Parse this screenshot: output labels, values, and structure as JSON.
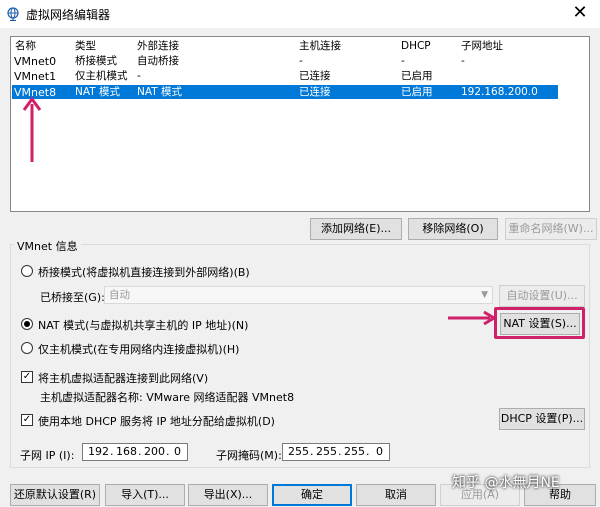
{
  "window": {
    "title": "虚拟网络编辑器",
    "close": "✕"
  },
  "table": {
    "headers": [
      "名称",
      "类型",
      "外部连接",
      "主机连接",
      "DHCP",
      "子网地址"
    ],
    "rows": [
      [
        "VMnet0",
        "桥接模式",
        "自动桥接",
        "-",
        "-",
        "-"
      ],
      [
        "VMnet1",
        "仅主机模式",
        "-",
        "已连接",
        "已启用",
        ""
      ],
      [
        "VMnet8",
        "NAT 模式",
        "NAT 模式",
        "已连接",
        "已启用",
        "192.168.200.0"
      ]
    ],
    "selected_row": 2
  },
  "list_buttons": {
    "add": "添加网络(E)...",
    "remove": "移除网络(O)",
    "rename": "重命名网络(W)..."
  },
  "vmnet_info": {
    "title": "VMnet 信息",
    "bridge_label": "桥接模式(将虚拟机直接连接到外部网络)(B)",
    "bridged_to_label": "已桥接至(G):",
    "bridged_to_value": "自动",
    "auto_settings": "自动设置(U)...",
    "nat_label": "NAT 模式(与虚拟机共享主机的 IP 地址)(N)",
    "nat_settings": "NAT 设置(S)...",
    "hostonly_label": "仅主机模式(在专用网络内连接虚拟机)(H)",
    "connect_adapter_label": "将主机虚拟适配器连接到此网络(V)",
    "adapter_name_text": "主机虚拟适配器名称: VMware 网络适配器 VMnet8",
    "dhcp_label": "使用本地 DHCP 服务将 IP 地址分配给虚拟机(D)",
    "dhcp_settings": "DHCP 设置(P)...",
    "subnet_ip_label": "子网 IP (I):",
    "subnet_ip": [
      "192",
      "168",
      "200",
      "0"
    ],
    "subnet_mask_label": "子网掩码(M):",
    "subnet_mask": [
      "255",
      "255",
      "255",
      "0"
    ]
  },
  "bottom_buttons": {
    "restore": "还原默认设置(R)",
    "import": "导入(T)...",
    "export": "导出(X)...",
    "ok": "确定",
    "cancel": "取消",
    "apply": "应用(A)",
    "help": "帮助"
  },
  "watermark": "知乎 @水無月NE",
  "colors": {
    "selection": "#0078d7",
    "annotation": "#d0206a"
  }
}
